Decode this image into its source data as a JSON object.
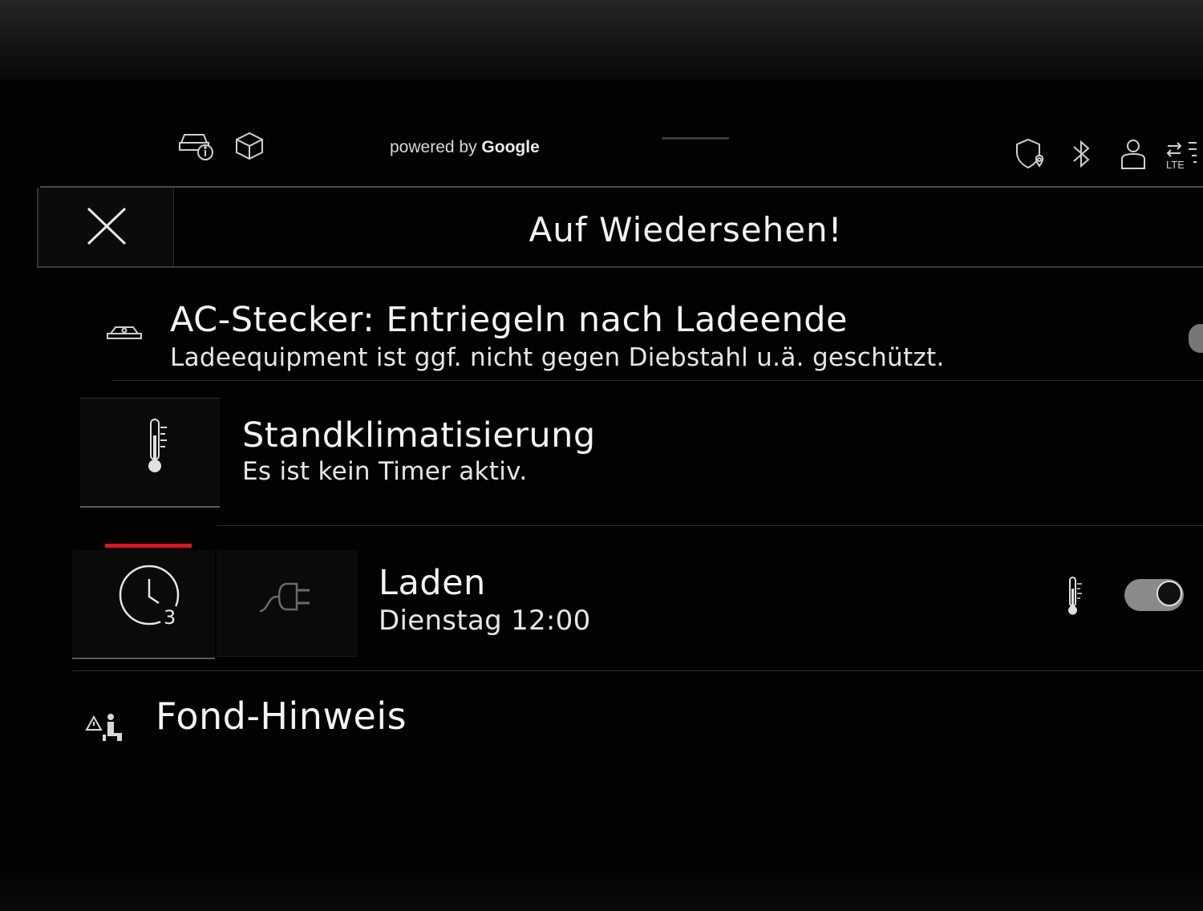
{
  "status_bar": {
    "powered_prefix": "powered by",
    "powered_brand": "Google",
    "icons": [
      "car-info-icon",
      "cube-icon",
      "shield-location-icon",
      "bluetooth-icon",
      "profile-icon",
      "lte-signal-icon"
    ],
    "lte_label": "LTE"
  },
  "header": {
    "title": "Auf Wiedersehen!",
    "close_icon": "close-icon"
  },
  "rows": [
    {
      "title": "AC-Stecker: Entriegeln nach Ladeende",
      "subtitle": "Ladeequipment ist ggf. nicht gegen Diebstahl u.ä. geschützt.",
      "icon": "car-plug-icon"
    },
    {
      "title": "Standklimatisierung",
      "subtitle": "Es ist kein Timer aktiv.",
      "icon": "thermometer-icon"
    },
    {
      "title": "Laden",
      "subtitle": "Dienstag 12:00",
      "timer_number": "3",
      "icons": [
        "timer-clock-icon",
        "charging-plug-icon",
        "thermometer-icon"
      ],
      "toggle_on": true
    },
    {
      "title": "Fond-Hinweis",
      "icon": "rear-seat-warning-icon"
    }
  ],
  "colors": {
    "background": "#000000",
    "accent_red": "#e0141e",
    "text": "#f2f2f2"
  }
}
